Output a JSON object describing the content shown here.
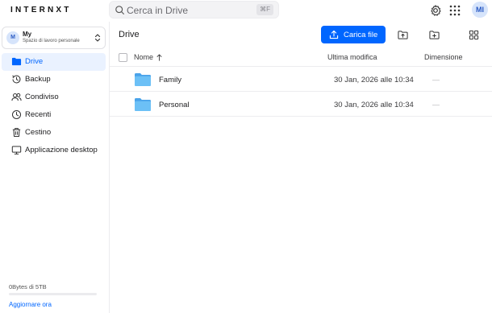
{
  "brand": {
    "logo": "INTERNXT"
  },
  "search": {
    "placeholder": "Cerca in Drive",
    "shortcut": "⌘F"
  },
  "header": {
    "settings_icon": "gear-icon",
    "apps_icon": "grid-dots-icon",
    "avatar_initials": "MI"
  },
  "workspace": {
    "initial": "M",
    "name": "My",
    "subtitle": "Spazio di lavoro personale"
  },
  "sidebar": {
    "items": [
      {
        "label": "Drive",
        "icon": "folder-icon",
        "active": true
      },
      {
        "label": "Backup",
        "icon": "history-icon",
        "active": false
      },
      {
        "label": "Condiviso",
        "icon": "users-icon",
        "active": false
      },
      {
        "label": "Recenti",
        "icon": "clock-icon",
        "active": false
      },
      {
        "label": "Cestino",
        "icon": "trash-icon",
        "active": false
      },
      {
        "label": "Applicazione desktop",
        "icon": "desktop-icon",
        "active": false
      }
    ],
    "storage_text": "0Bytes di 5TB",
    "storage_used_fraction": 0,
    "upgrade_label": "Aggiornare ora"
  },
  "main": {
    "breadcrumb": "Drive",
    "upload_label": "Carica file",
    "columns": {
      "name": "Nome",
      "modified": "Ultima modifica",
      "size": "Dimensione"
    },
    "rows": [
      {
        "name": "Family",
        "modified": "30 Jan, 2026 alle 10:34",
        "size": "—"
      },
      {
        "name": "Personal",
        "modified": "30 Jan, 2026 alle 10:34",
        "size": "—"
      }
    ]
  },
  "colors": {
    "accent": "#0066ff",
    "folder": "#5ab0f0",
    "active_bg": "#eaf2ff"
  }
}
